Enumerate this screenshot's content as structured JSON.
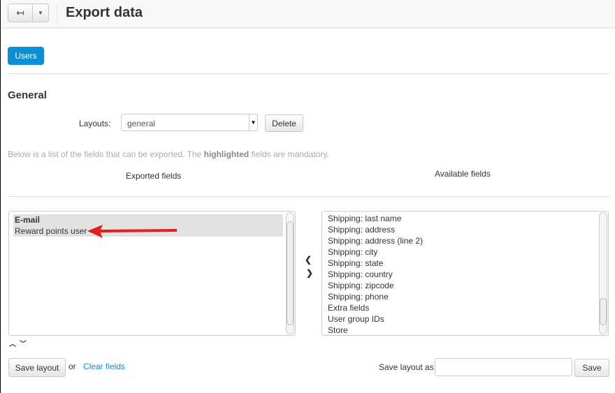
{
  "header": {
    "title": "Export data",
    "back_icon": "back-arrow-icon",
    "dropdown_icon": "caret-down-icon"
  },
  "tabs": [
    {
      "label": "Users",
      "active": true,
      "color": "#0b8fd3"
    }
  ],
  "section": {
    "title": "General"
  },
  "layouts": {
    "label": "Layouts:",
    "selected": "general",
    "delete_label": "Delete"
  },
  "hint": {
    "before": "Below is a list of the fields that can be exported. The ",
    "bold": "highlighted",
    "after": " fields are mandatory."
  },
  "exported": {
    "heading": "Exported fields",
    "items": [
      {
        "label": "E-mail",
        "mandatory": true
      },
      {
        "label": "Reward points user",
        "mandatory": false
      }
    ]
  },
  "available": {
    "heading": "Available fields",
    "items": [
      "Shipping: last name",
      "Shipping: address",
      "Shipping: address (line 2)",
      "Shipping: city",
      "Shipping: state",
      "Shipping: country",
      "Shipping: zipcode",
      "Shipping: phone",
      "Extra fields",
      "User group IDs",
      "Store"
    ]
  },
  "footer": {
    "save_layout": "Save layout",
    "or": "or",
    "clear_fields": "Clear fields",
    "save_as_label": "Save layout as:",
    "save_as_value": "",
    "save": "Save"
  },
  "annotation": {
    "arrow_color": "#e02020"
  }
}
